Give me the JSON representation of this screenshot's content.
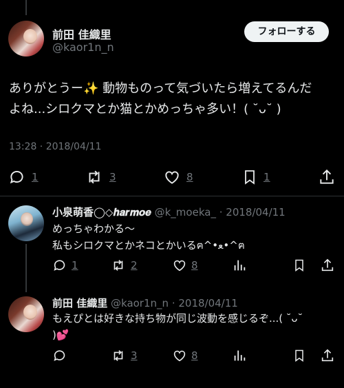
{
  "main_tweet": {
    "author_name": "前田 佳織里",
    "author_handle": "@kaor1n_n",
    "follow_label": "フォローする",
    "text_line1": "ありがとうー✨ 動物ものって気づいたら増えてるんだ",
    "text_line2": "よね...シロクマとか猫とかめっちゃ多い！( ˘ᴗ˘ )",
    "timestamp": "13:28 · 2018/04/11",
    "actions": {
      "reply": "1",
      "retweet": "3",
      "like": "8",
      "bookmark": "1"
    }
  },
  "replies": [
    {
      "author_name": "小泉萌香◯◇𝒉𝒂𝒓𝒎𝒐𝒆",
      "author_handle": "@k_moeka_",
      "date": "· 2018/04/11",
      "text_line1": "めっちゃわかる〜",
      "text_line2": "私もシロクマとかネコとかいるฅ^•ﻌ•^ฅ",
      "actions": {
        "reply": "1",
        "retweet": "2",
        "like": "8"
      }
    },
    {
      "author_name": "前田 佳織里",
      "author_handle": "@kaor1n_n",
      "date": "· 2018/04/11",
      "text_line1": "もえぴとは好きな持ち物が同じ波動を感じるぞ...( ˘ᴗ˘",
      "text_line2": ")💕",
      "actions": {
        "retweet": "3",
        "like": "8"
      }
    }
  ],
  "icons": {
    "reply": "reply-icon",
    "retweet": "retweet-icon",
    "like": "heart-icon",
    "bookmark": "bookmark-icon",
    "share": "share-icon",
    "views": "views-icon"
  },
  "colors": {
    "background": "#000000",
    "text": "#e7e9ea",
    "muted": "#71767b",
    "divider": "#2f3336"
  }
}
